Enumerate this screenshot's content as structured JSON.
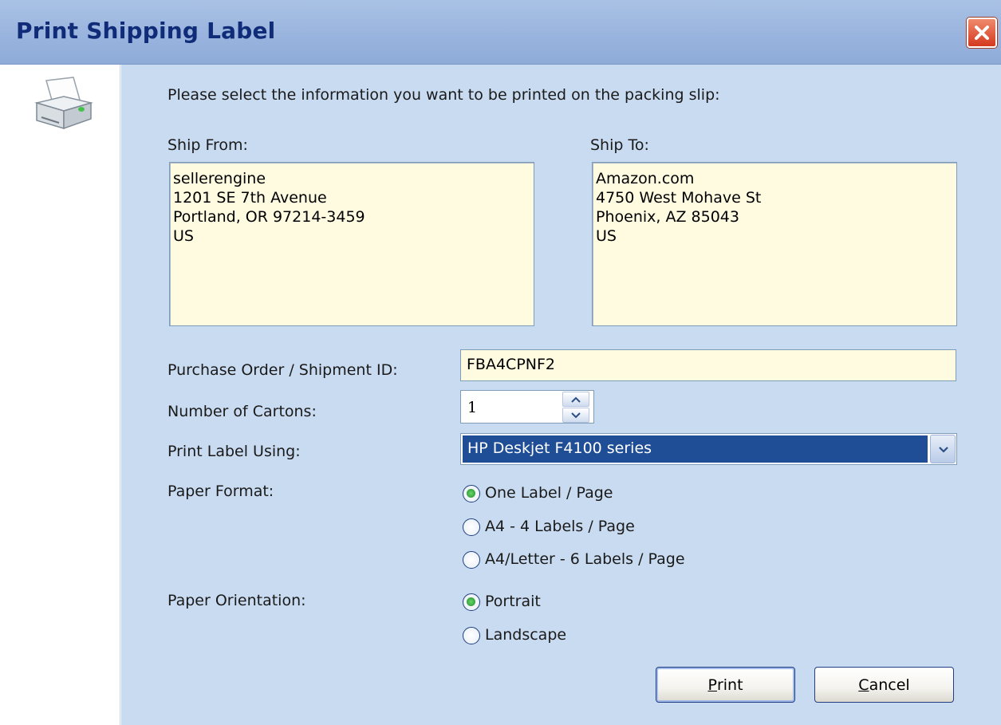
{
  "window": {
    "title": "Print Shipping Label"
  },
  "icons": {
    "printer": "printer-icon",
    "close": "close-icon"
  },
  "colors": {
    "title_bar": "#9cb6df",
    "content_bg": "#c9dbf1",
    "address_bg": "#fffbe0",
    "selected": "#1f4e96"
  },
  "instructions": "Please select the information you want to be printed on the packing slip:",
  "ship_from": {
    "label": "Ship From:",
    "lines": [
      "sellerengine",
      "1201 SE 7th Avenue",
      "Portland, OR 97214-3459",
      "US"
    ]
  },
  "ship_to": {
    "label": "Ship To:",
    "lines": [
      "Amazon.com",
      "4750 West Mohave St",
      "Phoenix, AZ 85043",
      "US"
    ]
  },
  "purchase_order": {
    "label": "Purchase Order / Shipment ID:",
    "value": "FBA4CPNF2"
  },
  "cartons": {
    "label": "Number of Cartons:",
    "value": "1"
  },
  "printer": {
    "label": "Print Label Using:",
    "value": "HP Deskjet F4100 series"
  },
  "paper_format": {
    "label": "Paper Format:",
    "options": [
      {
        "label": "One Label / Page",
        "selected": true
      },
      {
        "label": "A4 - 4 Labels / Page",
        "selected": false
      },
      {
        "label": "A4/Letter - 6 Labels / Page",
        "selected": false
      }
    ]
  },
  "paper_orientation": {
    "label": "Paper Orientation:",
    "options": [
      {
        "label": "Portrait",
        "selected": true
      },
      {
        "label": "Landscape",
        "selected": false
      }
    ]
  },
  "buttons": {
    "print": {
      "label": "Print",
      "mnemonic": "P",
      "rest": "rint"
    },
    "cancel": {
      "label": "Cancel",
      "mnemonic": "C",
      "rest": "ancel"
    }
  }
}
